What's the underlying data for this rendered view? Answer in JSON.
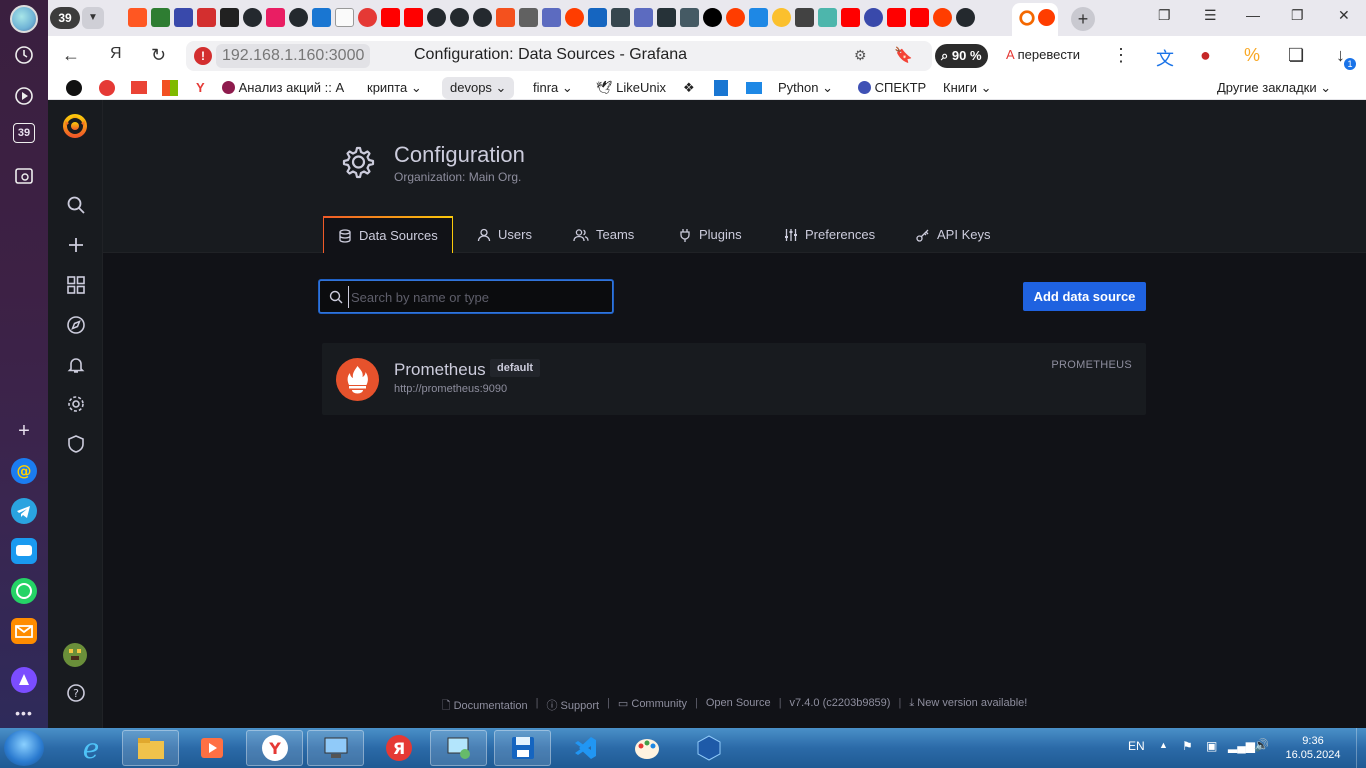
{
  "browser": {
    "tab_count": "39",
    "url_host": "192.168.1.160:3000",
    "page_title": "Configuration: Data Sources - Grafana",
    "zoom": "90 %",
    "translate_label": "перевести",
    "download_badge": "1",
    "side_counter": "39"
  },
  "bookmarks": {
    "items": [
      "Анализ акций :: А",
      "крипта",
      "devops",
      "finra",
      "LikeUnix",
      "Python",
      "СПЕКТР",
      "Книги"
    ],
    "other": "Другие закладки"
  },
  "grafana": {
    "header": {
      "title": "Configuration",
      "subtitle": "Organization: Main Org."
    },
    "tabs": [
      {
        "label": "Data Sources",
        "icon": "database-icon"
      },
      {
        "label": "Users",
        "icon": "user-icon"
      },
      {
        "label": "Teams",
        "icon": "users-icon"
      },
      {
        "label": "Plugins",
        "icon": "plug-icon"
      },
      {
        "label": "Preferences",
        "icon": "sliders-icon"
      },
      {
        "label": "API Keys",
        "icon": "key-icon"
      }
    ],
    "search": {
      "placeholder": "Search by name or type",
      "value": ""
    },
    "add_button": "Add data source",
    "datasource": {
      "name": "Prometheus",
      "badge": "default",
      "url": "http://prometheus:9090",
      "type": "PROMETHEUS"
    },
    "footer": {
      "documentation": "Documentation",
      "support": "Support",
      "community": "Community",
      "open_source": "Open Source",
      "version": "v7.4.0 (c2203b9859)",
      "new_version": "New version available!"
    }
  },
  "taskbar": {
    "lang": "EN",
    "time": "9:36",
    "date": "16.05.2024"
  },
  "colors": {
    "accent_blue": "#1f62e0",
    "grafana_bg": "#111217",
    "grafana_panel": "#181b1f",
    "prometheus_orange": "#e6522c"
  }
}
